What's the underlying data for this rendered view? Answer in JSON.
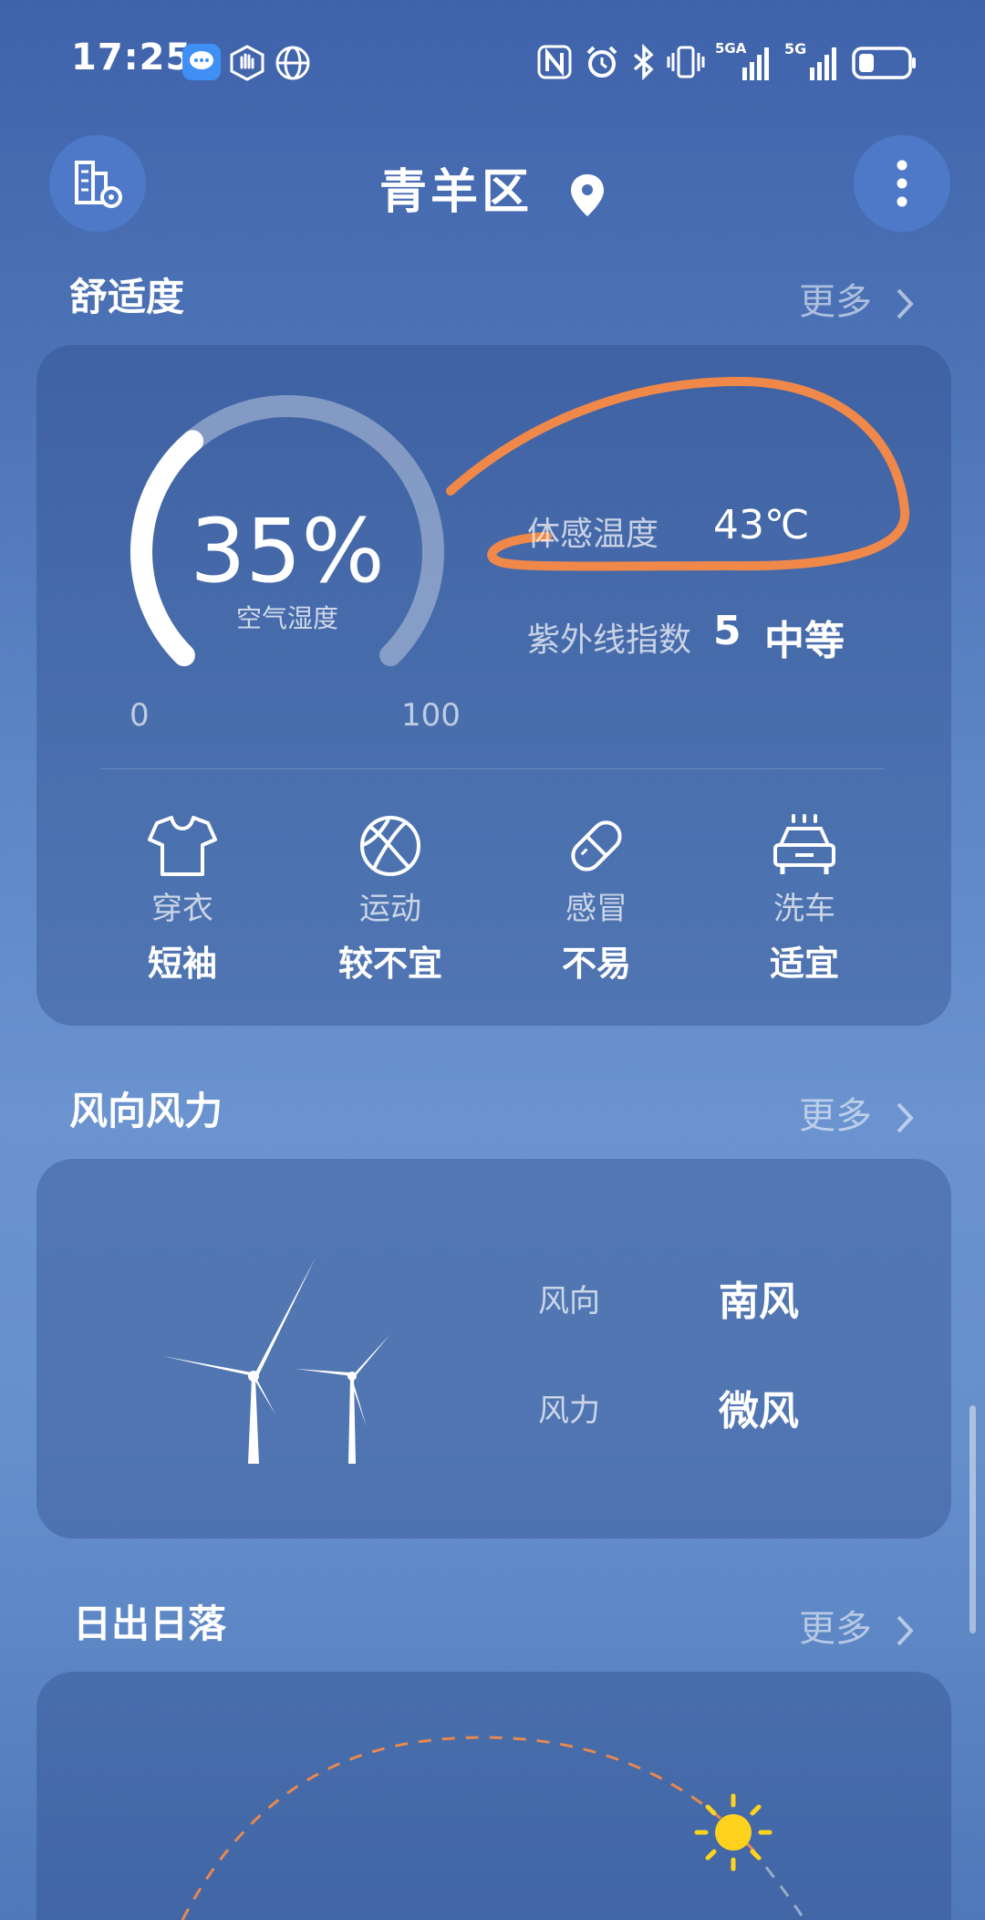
{
  "status_bar": {
    "time": "17:25",
    "left_icons": [
      "message-icon",
      "hand-icon",
      "globe-icon"
    ],
    "right_icons": [
      "nfc-icon",
      "alarm-icon",
      "bluetooth-icon",
      "vibrate-icon",
      "signal-5g-icon",
      "signal-5g-icon",
      "battery-icon"
    ],
    "sim1_label": "5GA",
    "sim2_label": "5G"
  },
  "header": {
    "location": "青羊区",
    "left_button_icon": "city-settings-icon",
    "right_button_icon": "more-vertical-icon",
    "location_icon": "location-pin-icon"
  },
  "comfort": {
    "title": "舒适度",
    "more": "更多",
    "humidity": {
      "value": "35%",
      "label": "空气湿度",
      "min": "0",
      "max": "100",
      "level": 0.35
    },
    "feels_like_label": "体感温度",
    "feels_like_value": "43℃",
    "uv_label": "紫外线指数",
    "uv_value": "5",
    "uv_level": "中等",
    "indices": [
      {
        "icon": "shirt-icon",
        "label": "穿衣",
        "value": "短袖"
      },
      {
        "icon": "ball-icon",
        "label": "运动",
        "value": "较不宜"
      },
      {
        "icon": "pill-icon",
        "label": "感冒",
        "value": "不易"
      },
      {
        "icon": "car-wash-icon",
        "label": "洗车",
        "value": "适宜"
      }
    ],
    "annotation_color": "#f0884a"
  },
  "wind": {
    "title": "风向风力",
    "more": "更多",
    "direction_label": "风向",
    "direction_value": "南风",
    "force_label": "风力",
    "force_value": "微风"
  },
  "sun": {
    "title": "日出日落",
    "more": "更多"
  },
  "colors": {
    "accent_button": "#4d79c8",
    "sun": "#ffd21e",
    "arc": "#e8894f"
  }
}
